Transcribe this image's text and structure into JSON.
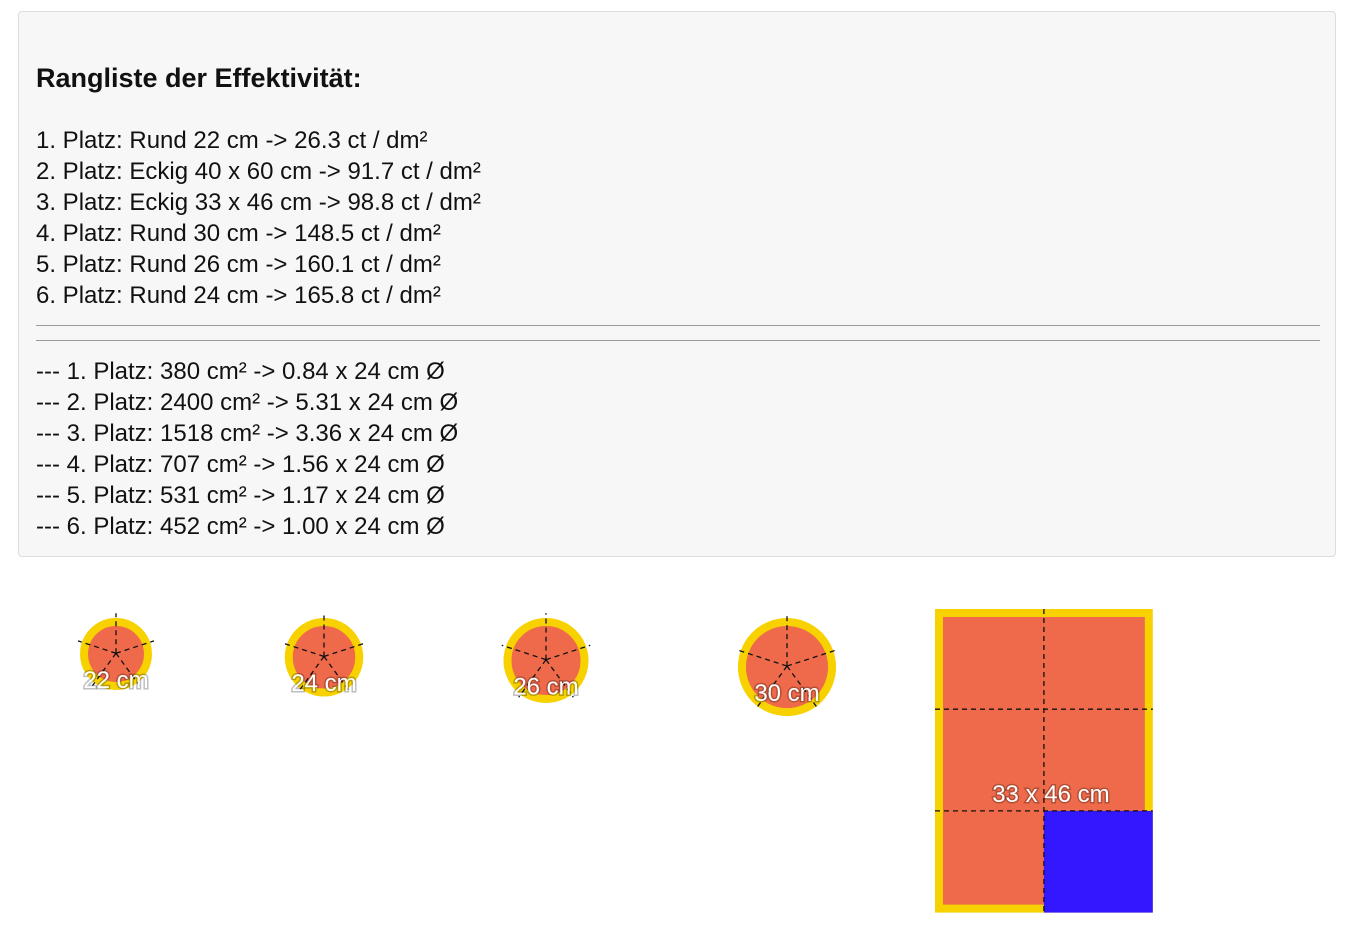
{
  "ranking": {
    "heading": "Rangliste der Effektivität:",
    "items": [
      "1. Platz: Rund 22 cm -> 26.3 ct / dm²",
      "2. Platz: Eckig 40 x 60 cm -> 91.7 ct / dm²",
      "3. Platz: Eckig 33 x 46 cm -> 98.8 ct / dm²",
      "4. Platz: Rund 30 cm -> 148.5 ct / dm²",
      "5. Platz: Rund 26 cm -> 160.1 ct / dm²",
      "6. Platz: Rund 24 cm -> 165.8 ct / dm²"
    ],
    "details": [
      "--- 1. Platz: 380 cm² -> 0.84 x 24 cm Ø",
      "--- 2. Platz: 2400 cm² -> 5.31 x 24 cm Ø",
      "--- 3. Platz: 1518 cm² -> 3.36 x 24 cm Ø",
      "--- 4. Platz: 707 cm² -> 1.56 x 24 cm Ø",
      "--- 5. Platz: 531 cm² -> 1.17 x 24 cm Ø",
      "--- 6. Platz: 452 cm² -> 1.00 x 24 cm Ø"
    ]
  },
  "pizzas": {
    "round": [
      {
        "label": "22 cm",
        "diameter_cm": 22
      },
      {
        "label": "24 cm",
        "diameter_cm": 24
      },
      {
        "label": "26 cm",
        "diameter_cm": 26
      },
      {
        "label": "30 cm",
        "diameter_cm": 30
      }
    ],
    "rect": {
      "label": "33 x 46 cm",
      "width_cm": 33,
      "height_cm": 46
    }
  },
  "colors": {
    "pizza_fill": "#ef6a4a",
    "crust": "#f7d200",
    "highlight": "#3317ff",
    "cut_lines": "#111111"
  }
}
